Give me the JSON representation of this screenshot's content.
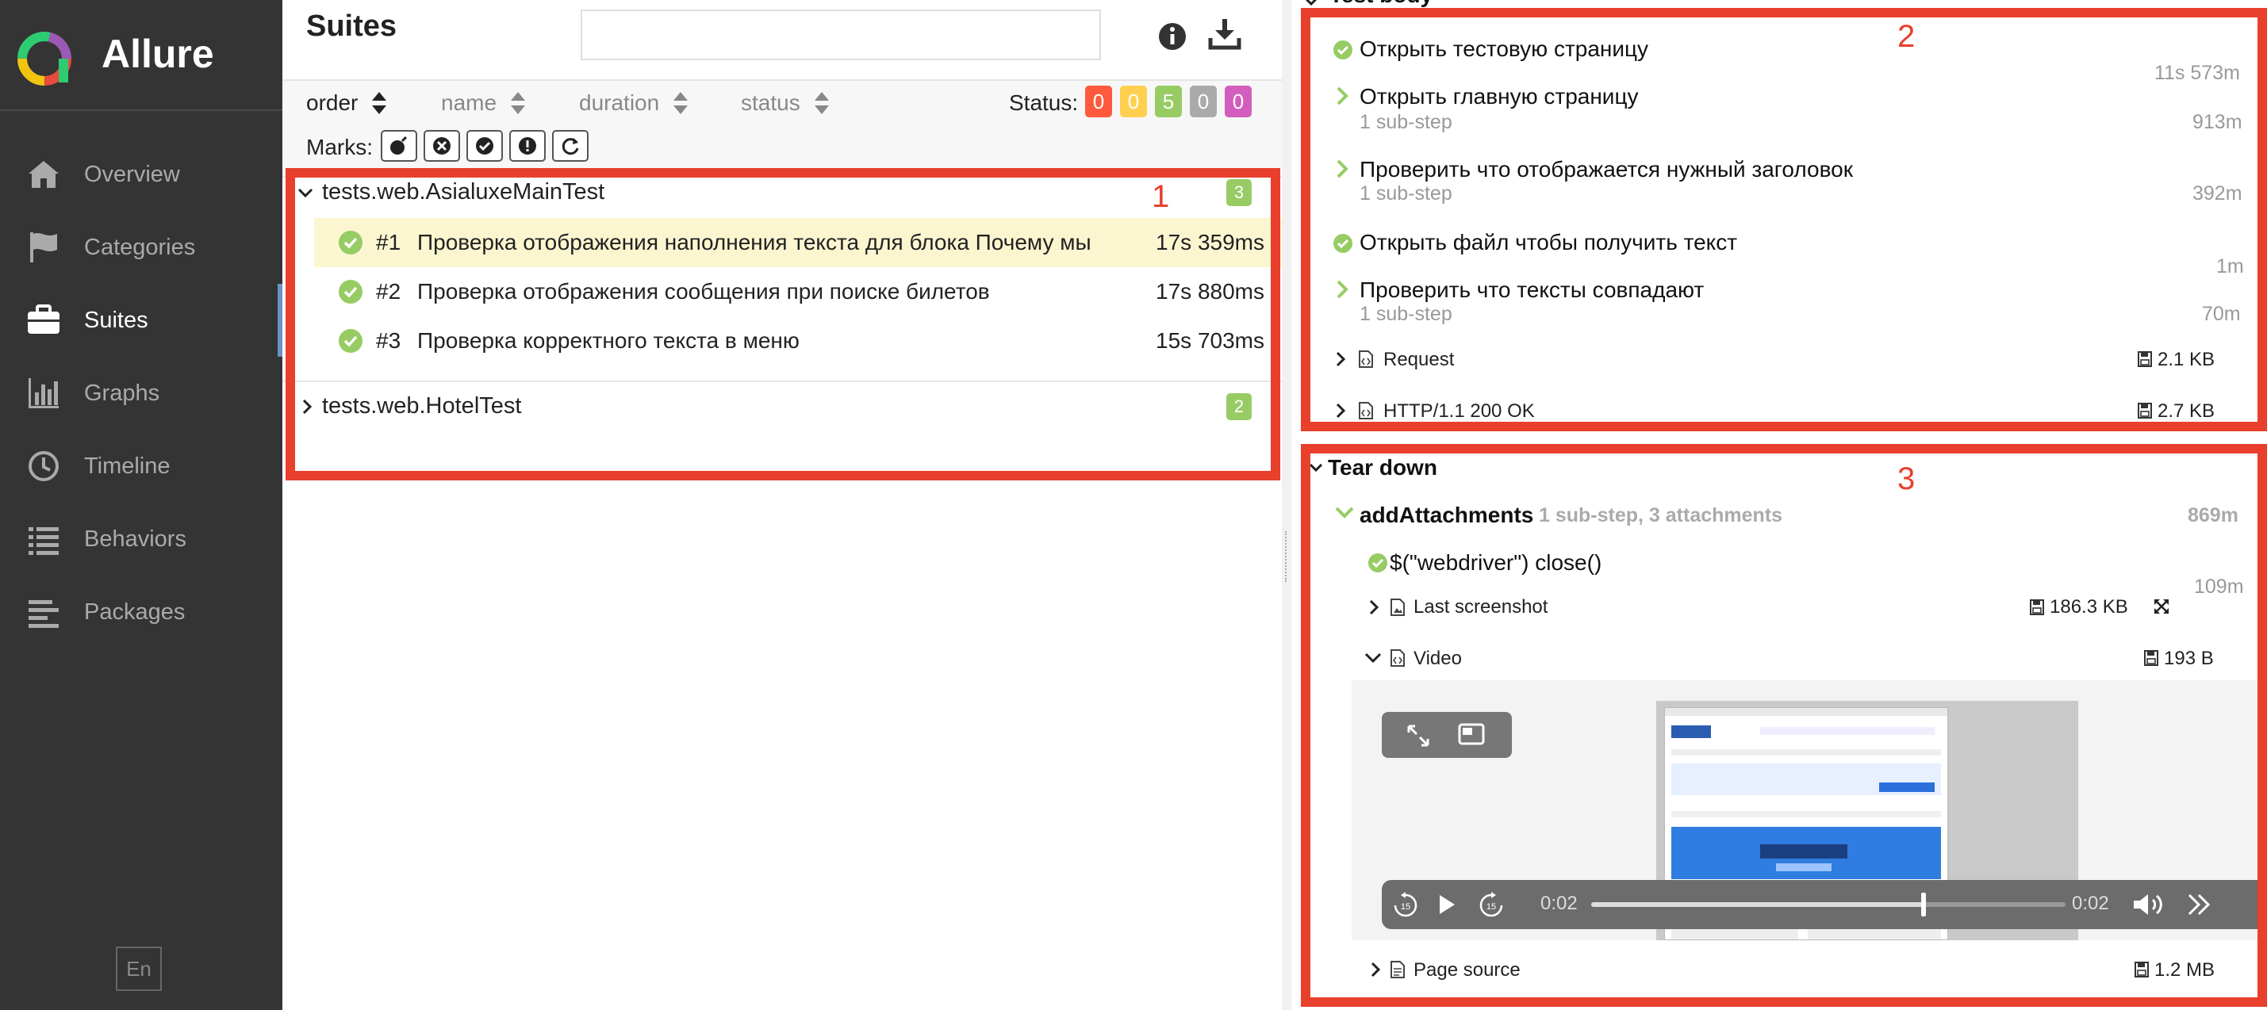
{
  "app": {
    "name": "Allure"
  },
  "sidebar": {
    "items": [
      {
        "label": "Overview",
        "icon": "home-icon"
      },
      {
        "label": "Categories",
        "icon": "flag-icon"
      },
      {
        "label": "Suites",
        "icon": "briefcase-icon",
        "active": true
      },
      {
        "label": "Graphs",
        "icon": "bar-chart-icon"
      },
      {
        "label": "Timeline",
        "icon": "clock-icon"
      },
      {
        "label": "Behaviors",
        "icon": "list-icon"
      },
      {
        "label": "Packages",
        "icon": "align-left-icon"
      }
    ],
    "language": "En"
  },
  "suites": {
    "title": "Suites",
    "search": {
      "value": "",
      "placeholder": ""
    },
    "sort": {
      "order": "order",
      "name": "name",
      "duration": "duration",
      "status": "status"
    },
    "status_label": "Status:",
    "status_counts": [
      {
        "value": "0",
        "color": "#fd5a3e"
      },
      {
        "value": "0",
        "color": "#ffd050"
      },
      {
        "value": "5",
        "color": "#97cc64"
      },
      {
        "value": "0",
        "color": "#aaaaaa"
      },
      {
        "value": "0",
        "color": "#d35ebe"
      }
    ],
    "marks_label": "Marks:",
    "groups": [
      {
        "name": "tests.web.AsialuxeMainTest",
        "count": "3",
        "expanded": true,
        "tests": [
          {
            "num": "#1",
            "name": "Проверка отображения наполнения текста для блока Почему мы",
            "duration": "17s 359ms"
          },
          {
            "num": "#2",
            "name": "Проверка отображения сообщения при поиске билетов",
            "duration": "17s 880ms"
          },
          {
            "num": "#3",
            "name": "Проверка корректного текста в меню",
            "duration": "15s 703ms"
          }
        ]
      },
      {
        "name": "tests.web.HotelTest",
        "count": "2",
        "expanded": false
      }
    ]
  },
  "annotations": [
    "1",
    "2",
    "3"
  ],
  "details": {
    "test_body_header": "Test body",
    "steps": [
      {
        "label": "Открыть тестовую страницу",
        "time": "11s 573m"
      },
      {
        "label": "Открыть главную страницу",
        "sub": "1 sub-step",
        "time": "913m"
      },
      {
        "label": "Проверить что отображается нужный заголовок",
        "sub": "1 sub-step",
        "time": "392m"
      },
      {
        "label": "Открыть файл чтобы получить текст",
        "time": "1m"
      },
      {
        "label": "Проверить что тексты совпадают",
        "sub": "1 sub-step",
        "time": "70m"
      }
    ],
    "attachments_body": [
      {
        "name": "Request",
        "size": "2.1 KB"
      },
      {
        "name": "HTTP/1.1 200 OK",
        "size": "2.7 KB"
      }
    ],
    "teardown": {
      "title": "Tear down",
      "step": "addAttachments",
      "step_meta": "1 sub-step, 3 attachments",
      "step_time": "869m",
      "substep": "$(\"webdriver\") close()",
      "substep_time": "109m",
      "attachments": [
        {
          "name": "Last screenshot",
          "size": "186.3 KB"
        },
        {
          "name": "Video",
          "size": "193 B"
        },
        {
          "name": "Page source",
          "size": "1.2 MB"
        }
      ],
      "video": {
        "current": "0:02",
        "total": "0:02",
        "progress": 0.7,
        "skip": "15"
      }
    }
  }
}
